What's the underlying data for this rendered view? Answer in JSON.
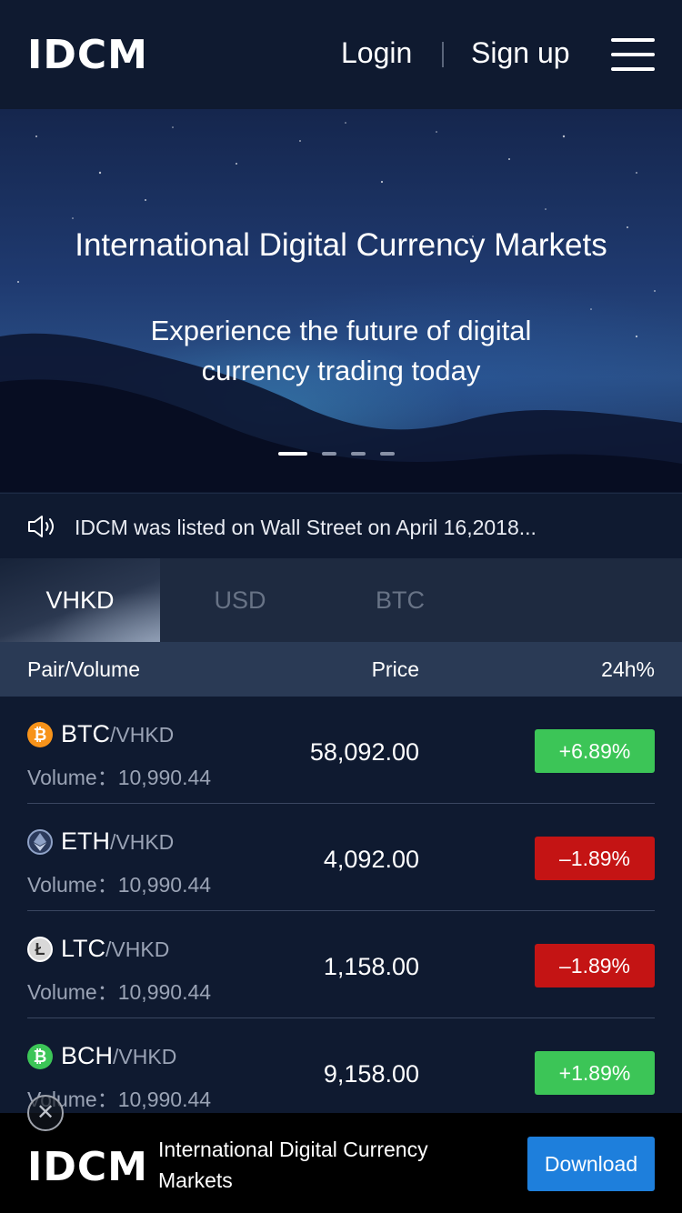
{
  "header": {
    "logo_text": "IDCM",
    "login_label": "Login",
    "signup_label": "Sign up"
  },
  "banner": {
    "title": "International Digital Currency Markets",
    "subtitle": "Experience the future of digital currency trading today",
    "slide_count": 4,
    "active_slide": 1
  },
  "notice": {
    "text": "IDCM was listed on Wall Street on April 16,2018..."
  },
  "tabs": [
    {
      "label": "VHKD",
      "active": true
    },
    {
      "label": "USD",
      "active": false
    },
    {
      "label": "BTC",
      "active": false
    }
  ],
  "table": {
    "headers": {
      "pair": "Pair/Volume",
      "price": "Price",
      "change": "24h%"
    },
    "rows": [
      {
        "symbol": "BTC",
        "quote": "/VHKD",
        "volume": "Volume：10,990.44",
        "price": "58,092.00",
        "change": "+6.89%",
        "direction": "up",
        "icon": "bitcoin-icon",
        "icon_glyph": "₿",
        "icon_color": "#f7931a"
      },
      {
        "symbol": "ETH",
        "quote": "/VHKD",
        "volume": "Volume：10,990.44",
        "price": "4,092.00",
        "change": "–1.89%",
        "direction": "down",
        "icon": "ethereum-icon",
        "icon_glyph": "◆",
        "icon_color": "#8fa2c7"
      },
      {
        "symbol": "LTC",
        "quote": "/VHKD",
        "volume": "Volume：10,990.44",
        "price": "1,158.00",
        "change": "–1.89%",
        "direction": "down",
        "icon": "litecoin-icon",
        "icon_glyph": "Ł",
        "icon_color": "#bcbcbc"
      },
      {
        "symbol": "BCH",
        "quote": "/VHKD",
        "volume": "Volume：10,990.44",
        "price": "9,158.00",
        "change": "+1.89%",
        "direction": "up",
        "icon": "bitcoin-cash-icon",
        "icon_glyph": "₿",
        "icon_color": "#3cc557"
      }
    ]
  },
  "download_bar": {
    "logo_text": "IDCM",
    "text": "International Digital Currency Markets",
    "button_label": "Download"
  },
  "colors": {
    "background": "#0f1a30",
    "up": "#3cc557",
    "down": "#c41414",
    "download": "#1e7fdc"
  }
}
